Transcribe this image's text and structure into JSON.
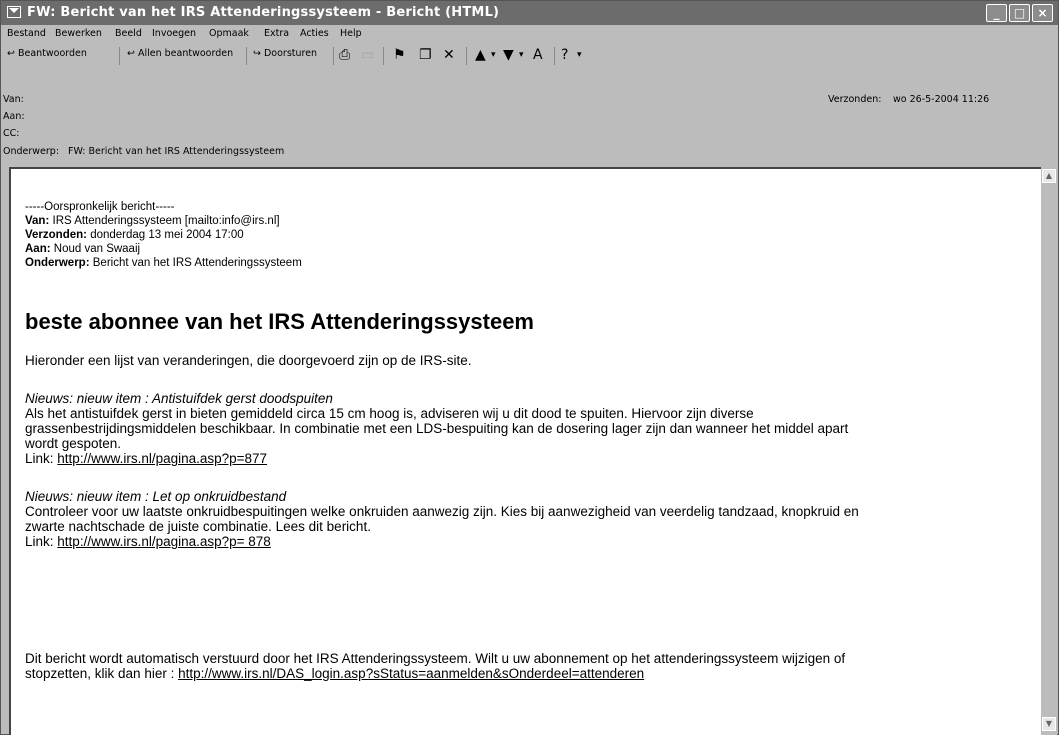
{
  "window": {
    "title": "FW: Bericht van het IRS Attenderingssysteem - Bericht (HTML)",
    "controls": {
      "minimize": "_",
      "maximize": "□",
      "close": "×"
    }
  },
  "menu": [
    "Bestand",
    "Bewerken",
    "Beeld",
    "Invoegen",
    "Opmaak",
    "Extra",
    "Acties",
    "Help"
  ],
  "toolbar": {
    "reply": "Beantwoorden",
    "reply_all": "Allen beantwoorden",
    "forward": "Doorsturen"
  },
  "headers": {
    "from_label": "Van:",
    "to_label": "Aan:",
    "cc_label": "CC:",
    "subject_label": "Onderwerp:",
    "subject": "FW: Bericht van het IRS Attenderingssysteem",
    "sent_label": "Verzonden:",
    "sent_value": "wo 26-5-2004 11:26"
  },
  "message": {
    "original_marker": "-----Oorspronkelijk bericht-----",
    "from_label": "Van:",
    "from_value": "IRS Attenderingssysteem [mailto:info@irs.nl]",
    "sent_label": "Verzonden:",
    "sent_value": "donderdag 13 mei 2004 17:00",
    "to_label": "Aan:",
    "to_value": "Noud van Swaaij",
    "subject_label": "Onderwerp:",
    "subject_value": "Bericht van het IRS Attenderingssysteem",
    "heading": "beste abonnee van het IRS Attenderingssysteem",
    "intro": "Hieronder een lijst van veranderingen, die doorgevoerd zijn op de IRS-site.",
    "item1_title": "Nieuws: nieuw item : Antistuifdek gerst doodspuiten",
    "item1_line1": "Als het antistuifdek gerst in bieten gemiddeld circa 15 cm hoog is, adviseren wij u dit dood te spuiten. Hiervoor zijn diverse",
    "item1_line2": "grassenbestrijdingsmiddelen beschikbaar. In combinatie met een LDS-bespuiting kan de dosering lager zijn dan wanneer het middel apart",
    "item1_line3": "wordt gespoten.",
    "item1_link_label": "Link:",
    "item1_link": "http://www.irs.nl/pagina.asp?p=877",
    "item2_title": "Nieuws: nieuw item : Let op onkruidbestand",
    "item2_line1": "Controleer voor uw laatste onkruidbespuitingen welke onkruiden aanwezig zijn. Kies bij aanwezigheid van veerdelig tandzaad, knopkruid en",
    "item2_line2": "zwarte nachtschade de juiste combinatie. Lees dit bericht.",
    "item2_link_label": "Link:",
    "item2_link": "http://www.irs.nl/pagina.asp?p= 878",
    "footer_line1": "Dit bericht wordt automatisch verstuurd door het IRS Attenderingssysteem. Wilt u uw abonnement op het attenderingssysteem wijzigen of",
    "footer_line2_prefix": "stopzetten, klik dan hier :",
    "footer_link": "http://www.irs.nl/DAS_login.asp?sStatus=aanmelden&sOnderdeel=attenderen"
  }
}
